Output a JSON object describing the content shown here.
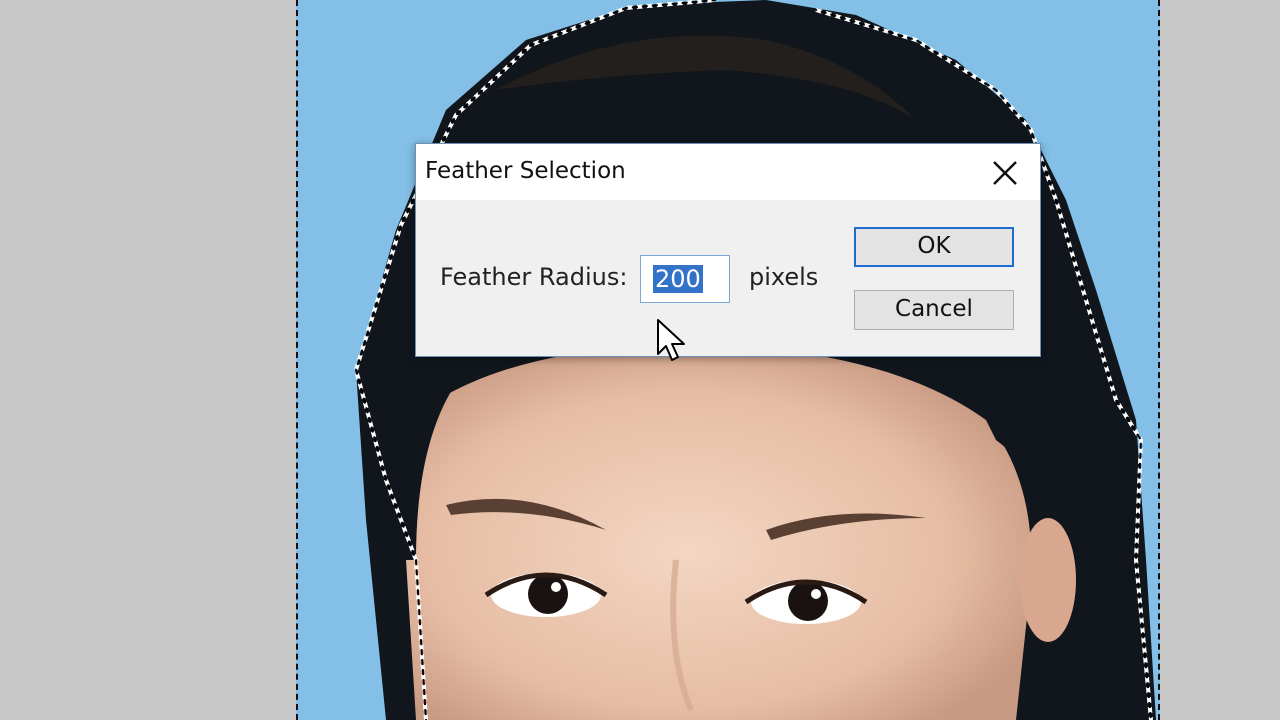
{
  "dialog": {
    "title": "Feather Selection",
    "radius_label": "Feather Radius:",
    "radius_value": "200",
    "unit_label": "pixels",
    "ok_label": "OK",
    "cancel_label": "Cancel"
  },
  "colors": {
    "canvas_background": "#83bfe6",
    "workspace_background": "#c8c8c8",
    "selection_highlight": "#3372c9",
    "default_button_border": "#1f6cd0"
  },
  "icons": {
    "close": "close-icon",
    "cursor": "mouse-pointer-icon"
  }
}
